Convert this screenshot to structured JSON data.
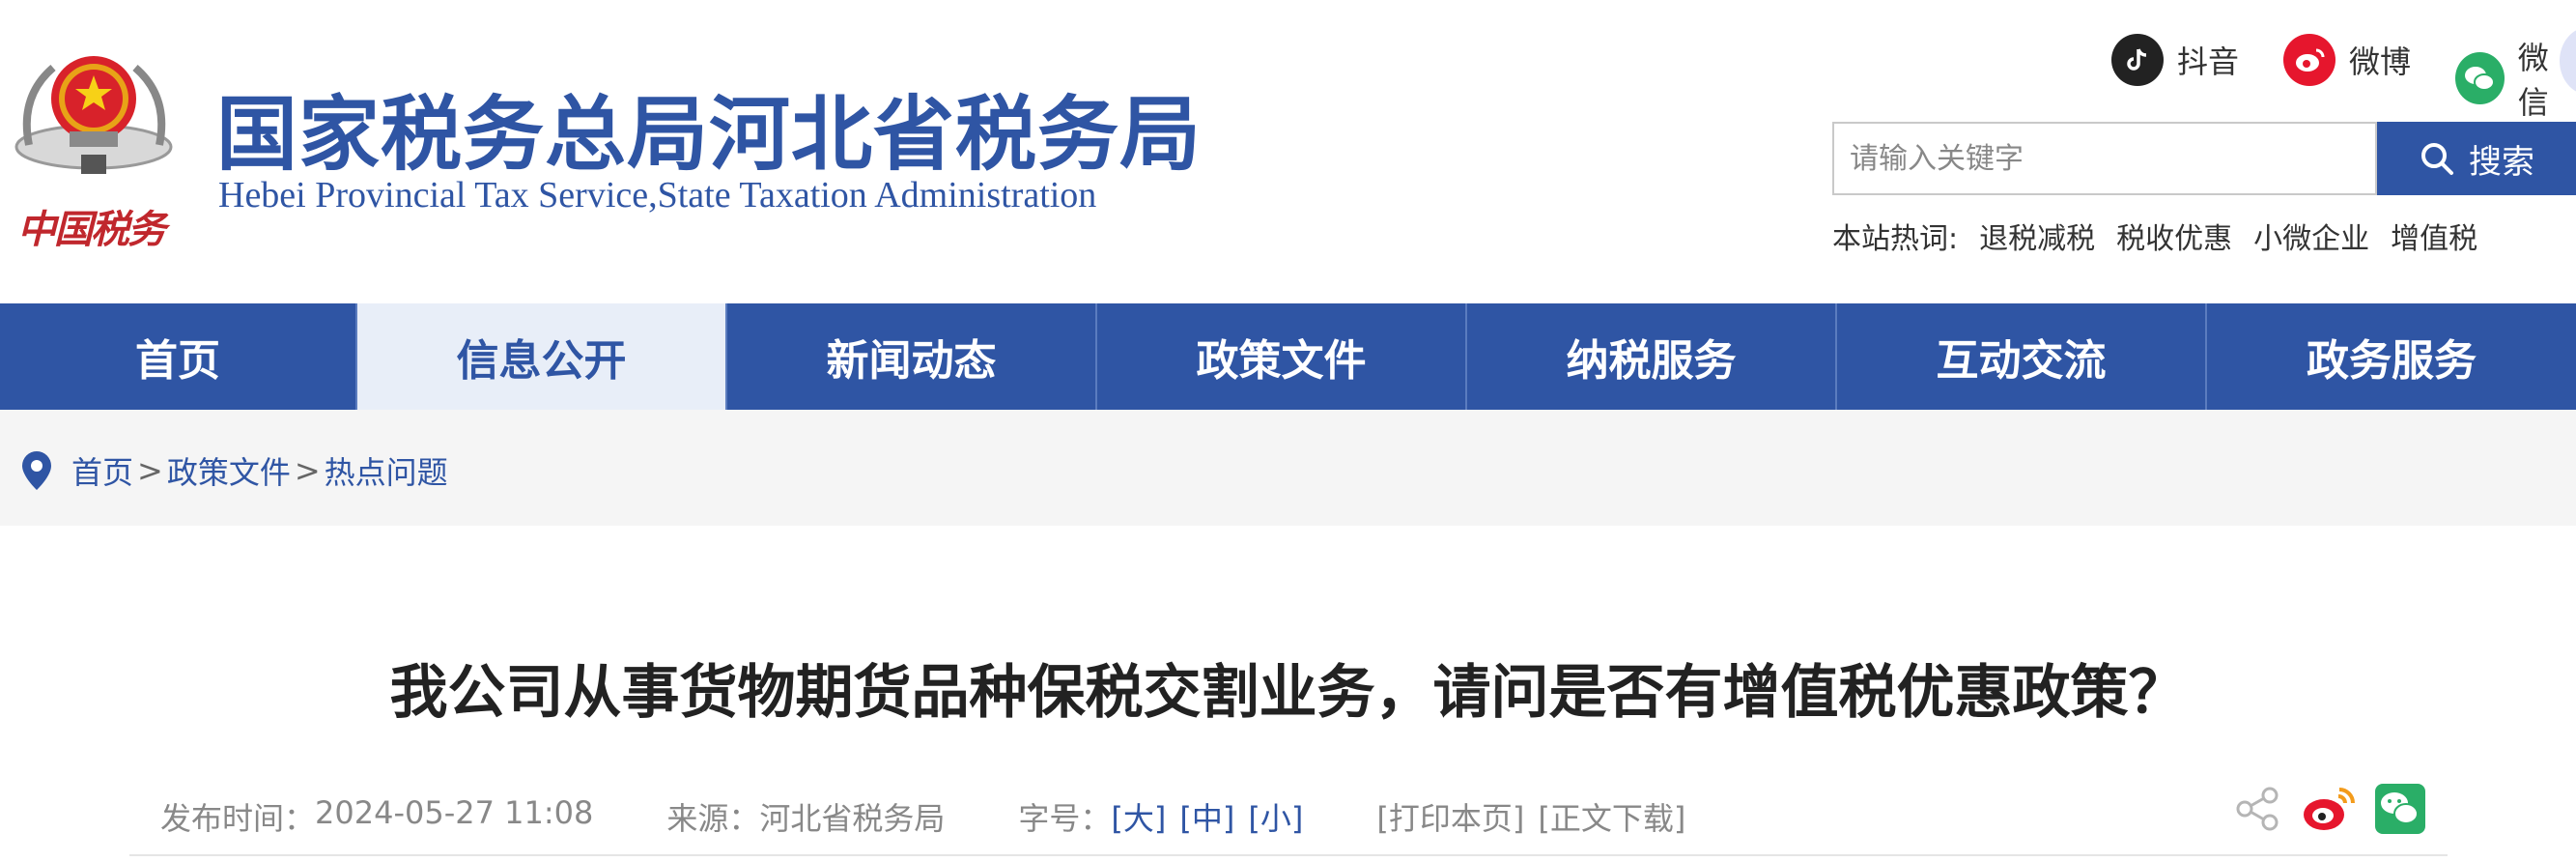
{
  "header": {
    "brand_script": "中国税务",
    "title": "国家税务总局河北省税务局",
    "subtitle": "Hebei Provincial Tax Service,State Taxation Administration",
    "social": [
      {
        "label": "抖音",
        "icon": "tiktok-icon",
        "color": "#222222"
      },
      {
        "label": "微博",
        "icon": "weibo-icon",
        "color": "#e6162d"
      },
      {
        "label": "微信",
        "icon": "wechat-icon",
        "color": "#2aae67"
      }
    ],
    "search": {
      "placeholder": "请输入关键字",
      "button_label": "搜索"
    },
    "hotwords": {
      "label": "本站热词:",
      "items": [
        "退税减税",
        "税收优惠",
        "小微企业",
        "增值税"
      ]
    }
  },
  "nav": {
    "items": [
      {
        "label": "首页",
        "active": false
      },
      {
        "label": "信息公开",
        "active": true
      },
      {
        "label": "新闻动态",
        "active": false
      },
      {
        "label": "政策文件",
        "active": false
      },
      {
        "label": "纳税服务",
        "active": false
      },
      {
        "label": "互动交流",
        "active": false
      },
      {
        "label": "政务服务",
        "active": false
      }
    ]
  },
  "breadcrumb": {
    "items": [
      "首页",
      "政策文件",
      "热点问题"
    ],
    "separator": ">"
  },
  "article": {
    "title": "我公司从事货物期货品种保税交割业务，请问是否有增值税优惠政策？",
    "publish_label": "发布时间：",
    "publish_time": "2024-05-27 11:08",
    "source_label": "来源：",
    "source": "河北省税务局",
    "font_label": "字号：",
    "font_large": "[大]",
    "font_medium": "[中]",
    "font_small": "[小]",
    "print": "[打印本页]",
    "download": "[正文下载]"
  },
  "colors": {
    "brand_blue": "#2f55a4",
    "nav_active_bg": "#e8eef8",
    "breadcrumb_bg": "#f5f5f5"
  }
}
